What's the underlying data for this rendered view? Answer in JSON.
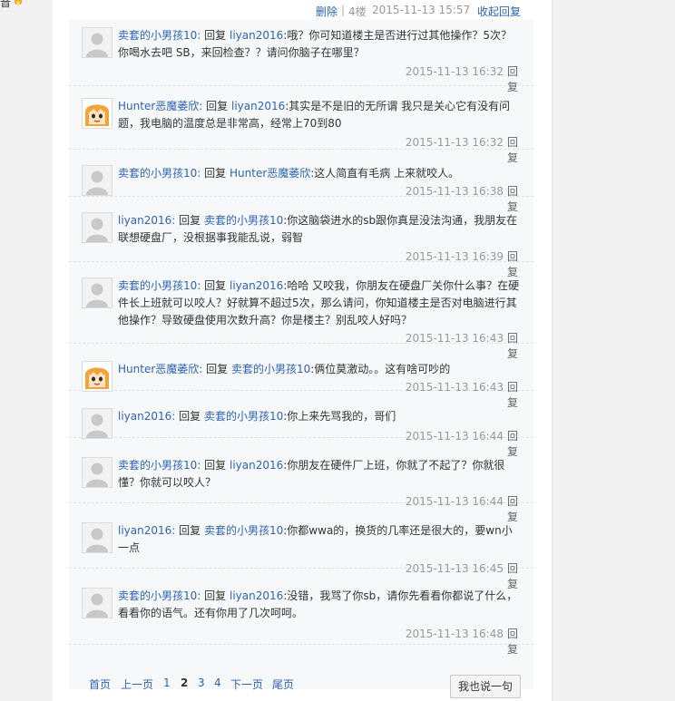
{
  "post_tail": {
    "delete": "删除",
    "sep": "|",
    "floor": "4楼",
    "time": "2015-11-13 15:57",
    "collapse": "收起回复"
  },
  "edge": {
    "text": "音"
  },
  "reply_word": "回复",
  "comments": [
    {
      "avatar": "default",
      "user": "卖套的小男孩10:",
      "target": "liyan2016",
      "text": ":哦？你可知道楼主是否进行过其他操作？5次？你喝水去吧 SB，来回检查？？请问你脑子在哪里？",
      "time": "2015-11-13 16:32",
      "reply": "回复"
    },
    {
      "avatar": "anime",
      "user": "Hunter恶魔萎欣:",
      "target": "liyan2016",
      "text": ":其实是不是旧的无所谓 我只是关心它有没有问题，我电脑的温度总是非常高，经常上70到80",
      "time": "2015-11-13 16:32",
      "reply": "回复"
    },
    {
      "avatar": "default",
      "user": "卖套的小男孩10:",
      "target": "Hunter恶魔萎欣",
      "text": ":这人简直有毛病 上来就咬人。",
      "time": "2015-11-13 16:38",
      "reply": "回复"
    },
    {
      "avatar": "default",
      "user": "liyan2016:",
      "target": "卖套的小男孩10",
      "text": ":你这脑袋进水的sb跟你真是没法沟通，我朋友在联想硬盘厂，没根据事我能乱说，弱智",
      "time": "2015-11-13 16:39",
      "reply": "回复"
    },
    {
      "avatar": "default",
      "user": "卖套的小男孩10:",
      "target": "liyan2016",
      "text": ":哈哈 又咬我，你朋友在硬盘厂关你什么事？在硬件长上班就可以咬人？好就算不超过5次，那么请问，你知道楼主是否对电脑进行其他操作？导致硬盘使用次数升高？你是楼主？别乱咬人好吗？",
      "time": "2015-11-13 16:43",
      "reply": "回复"
    },
    {
      "avatar": "anime",
      "user": "Hunter恶魔萎欣:",
      "target": "卖套的小男孩10",
      "text": ":俩位莫激动。。这有啥可吵的",
      "time": "2015-11-13 16:43",
      "reply": "回复"
    },
    {
      "avatar": "default",
      "user": "liyan2016:",
      "target": "卖套的小男孩10",
      "text": ":你上来先骂我的，哥们",
      "time": "2015-11-13 16:44",
      "reply": "回复"
    },
    {
      "avatar": "default",
      "user": "卖套的小男孩10:",
      "target": "liyan2016",
      "text": ":你朋友在硬件厂上班，你就了不起了？你就很懂？你就可以咬人？",
      "time": "2015-11-13 16:44",
      "reply": "回复"
    },
    {
      "avatar": "default",
      "user": "liyan2016:",
      "target": "卖套的小男孩10",
      "text": ":你都wwa的，换货的几率还是很大的，要wn小一点",
      "time": "2015-11-13 16:45",
      "reply": "回复"
    },
    {
      "avatar": "default",
      "user": "卖套的小男孩10:",
      "target": "liyan2016",
      "text": ":没错，我骂了你sb，请你先看看你都说了什么，看看你的语气。还有你用了几次呵呵。",
      "time": "2015-11-13 16:48",
      "reply": "回复"
    }
  ],
  "pager": {
    "first": "首页",
    "prev": "上一页",
    "pages": [
      "1",
      "2",
      "3",
      "4"
    ],
    "current": "2",
    "next": "下一页",
    "last": "尾页"
  },
  "say_button": "我也说一句",
  "colors": {
    "link": "#2d64b3",
    "muted": "#999999",
    "box_bg": "#f7f8fa",
    "side_bg": "#f1f1f1"
  }
}
